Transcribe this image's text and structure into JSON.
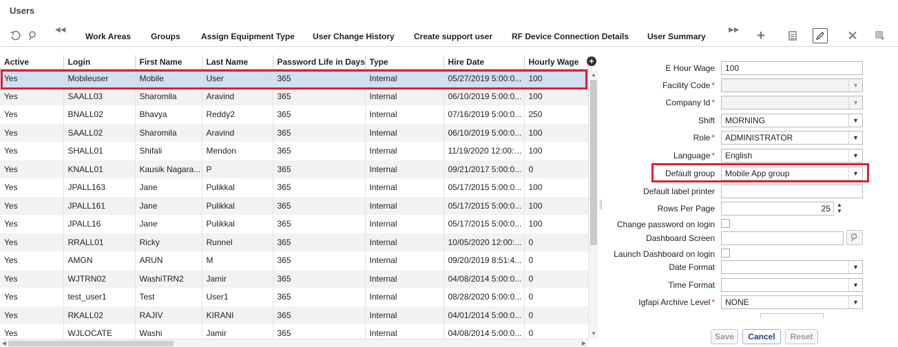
{
  "app": {
    "title": "Users"
  },
  "toolbar": {
    "links": [
      "Work Areas",
      "Groups",
      "Assign Equipment Type",
      "User Change History",
      "Create support user",
      "RF Device Connection Details",
      "User Summary"
    ],
    "icons": [
      "refresh-icon",
      "search-icon",
      "collapse-left-icon",
      "expand-right-icon",
      "add-icon",
      "list-icon",
      "edit-icon",
      "delete-icon",
      "grid-settings-icon"
    ]
  },
  "grid": {
    "columns": [
      "Active",
      "Login",
      "First Name",
      "Last Name",
      "Password Life in Days",
      "Type",
      "Hire Date",
      "Hourly Wage"
    ],
    "rows": [
      [
        "Yes",
        "Mobileuser",
        "Mobile",
        "User",
        "365",
        "Internal",
        "05/27/2019 5:00:0...",
        "100"
      ],
      [
        "Yes",
        "SAALL03",
        "Sharomila",
        "Aravind",
        "365",
        "Internal",
        "06/10/2019 5:00:0...",
        "100"
      ],
      [
        "Yes",
        "BNALL02",
        "Bhavya",
        "Reddy2",
        "365",
        "Internal",
        "07/16/2019 5:00:0...",
        "250"
      ],
      [
        "Yes",
        "SAALL02",
        "Sharomila",
        "Aravind",
        "365",
        "Internal",
        "06/10/2019 5:00:0...",
        "100"
      ],
      [
        "Yes",
        "SHALL01",
        "Shifali",
        "Mendon",
        "365",
        "Internal",
        "11/19/2020 12:00:0...",
        "100"
      ],
      [
        "Yes",
        "KNALL01",
        "Kausik Nagara...",
        "P",
        "365",
        "Internal",
        "09/21/2017 5:00:0...",
        "0"
      ],
      [
        "Yes",
        "JPALL163",
        "Jane",
        "Pulikkal",
        "365",
        "Internal",
        "05/17/2015 5:00:0...",
        "100"
      ],
      [
        "Yes",
        "JPALL161",
        "Jane",
        "Pulikkal",
        "365",
        "Internal",
        "05/17/2015 5:00:0...",
        "100"
      ],
      [
        "Yes",
        "JPALL16",
        "Jane",
        "Pulikkal",
        "365",
        "Internal",
        "05/17/2015 5:00:0...",
        "100"
      ],
      [
        "Yes",
        "RRALL01",
        "Ricky",
        "Runnel",
        "365",
        "Internal",
        "10/05/2020 12:00:...",
        "0"
      ],
      [
        "Yes",
        "AMGN",
        "ARUN",
        "M",
        "365",
        "Internal",
        "09/20/2019 8:51:4...",
        "0"
      ],
      [
        "Yes",
        "WJTRN02",
        "WashiTRN2",
        "Jamir",
        "365",
        "Internal",
        "04/08/2014 5:00:0...",
        "0"
      ],
      [
        "Yes",
        "test_user1",
        "Test",
        "User1",
        "365",
        "Internal",
        "08/28/2020 5:00:0...",
        "0"
      ],
      [
        "Yes",
        "RKALL02",
        "RAJIV",
        "KIRANI",
        "365",
        "Internal",
        "04/01/2014 5:00:0...",
        "0"
      ],
      [
        "Yes",
        "WJLOCATE",
        "Washi",
        "Jamir",
        "365",
        "Internal",
        "04/08/2014 5:00:0...",
        "0"
      ]
    ],
    "selected_row": 0
  },
  "form": {
    "e_hour_wage": {
      "label": "E Hour Wage",
      "value": "100"
    },
    "facility_code": {
      "label": "Facility Code",
      "value": ""
    },
    "company_id": {
      "label": "Company Id",
      "value": ""
    },
    "shift": {
      "label": "Shift",
      "value": "MORNING"
    },
    "role": {
      "label": "Role",
      "value": "ADMINISTRATOR"
    },
    "language": {
      "label": "Language",
      "value": "English"
    },
    "default_group": {
      "label": "Default group",
      "value": "Mobile App group"
    },
    "default_label_printer": {
      "label": "Default label printer",
      "value": ""
    },
    "rows_per_page": {
      "label": "Rows Per Page",
      "value": "25"
    },
    "change_password": {
      "label": "Change password on login"
    },
    "dashboard_screen": {
      "label": "Dashboard Screen",
      "value": ""
    },
    "launch_dashboard": {
      "label": "Launch Dashboard on login"
    },
    "date_format": {
      "label": "Date Format",
      "value": ""
    },
    "time_format": {
      "label": "Time Format",
      "value": ""
    },
    "archive_level": {
      "label": "Igfapi Archive Level",
      "value": "NONE"
    },
    "required_mark": "*"
  },
  "buttons": {
    "save": "Save",
    "cancel": "Cancel",
    "reset": "Reset"
  },
  "colors": {
    "highlight_outline": "#e0202f",
    "selected_row": "#cfe0ef",
    "primary_button_text": "#1d3f8a"
  }
}
